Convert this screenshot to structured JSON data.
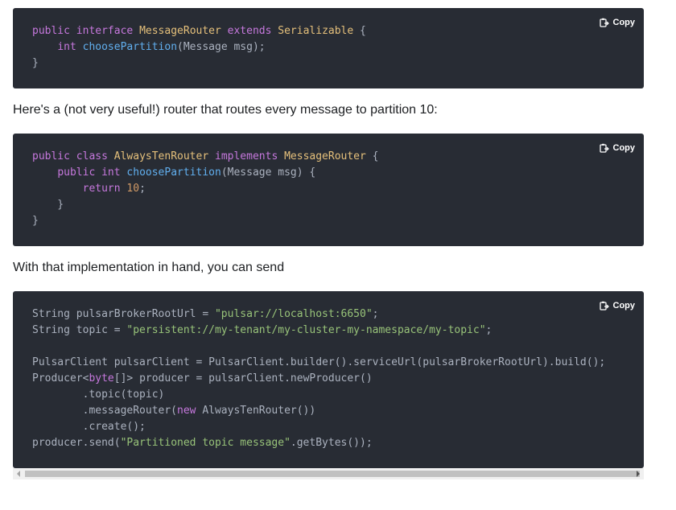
{
  "copy_label": "Copy",
  "icons": {
    "copy": "clipboard-copy-icon"
  },
  "paragraphs": [
    "Here's a (not very useful!) router that routes every message to partition 10:",
    "With that implementation in hand, you can send"
  ],
  "code_blocks": [
    {
      "lines": [
        [
          [
            "kw",
            "public "
          ],
          [
            "kw",
            "interface "
          ],
          [
            "cls",
            "MessageRouter "
          ],
          [
            "kw",
            "extends "
          ],
          [
            "cls",
            "Serializable "
          ],
          [
            "",
            "{"
          ]
        ],
        [
          [
            "",
            "    "
          ],
          [
            "kw",
            "int "
          ],
          [
            "fn",
            "choosePartition"
          ],
          [
            "",
            "(Message msg);"
          ]
        ],
        [
          [
            "",
            "}"
          ]
        ]
      ]
    },
    {
      "lines": [
        [
          [
            "kw",
            "public "
          ],
          [
            "kw",
            "class "
          ],
          [
            "cls",
            "AlwaysTenRouter "
          ],
          [
            "kw",
            "implements "
          ],
          [
            "cls",
            "MessageRouter "
          ],
          [
            "",
            "{"
          ]
        ],
        [
          [
            "",
            "    "
          ],
          [
            "kw",
            "public "
          ],
          [
            "kw",
            "int "
          ],
          [
            "fn",
            "choosePartition"
          ],
          [
            "",
            "(Message msg) {"
          ]
        ],
        [
          [
            "",
            "        "
          ],
          [
            "kw",
            "return "
          ],
          [
            "num",
            "10"
          ],
          [
            "",
            ";"
          ]
        ],
        [
          [
            "",
            "    }"
          ]
        ],
        [
          [
            "",
            "}"
          ]
        ]
      ]
    },
    {
      "lines": [
        [
          [
            "",
            "String pulsarBrokerRootUrl = "
          ],
          [
            "str",
            "\"pulsar://localhost:6650\""
          ],
          [
            "",
            ";"
          ]
        ],
        [
          [
            "",
            "String topic = "
          ],
          [
            "str",
            "\"persistent://my-tenant/my-cluster-my-namespace/my-topic\""
          ],
          [
            "",
            ";"
          ]
        ],
        [
          [
            "",
            ""
          ]
        ],
        [
          [
            "",
            "PulsarClient pulsarClient = PulsarClient.builder().serviceUrl(pulsarBrokerRootUrl).build();"
          ]
        ],
        [
          [
            "",
            "Producer<"
          ],
          [
            "kw",
            "byte"
          ],
          [
            "",
            "[]> producer = pulsarClient.newProducer()"
          ]
        ],
        [
          [
            "",
            "        .topic(topic)"
          ]
        ],
        [
          [
            "",
            "        .messageRouter("
          ],
          [
            "kw",
            "new "
          ],
          [
            "",
            "AlwaysTenRouter())"
          ]
        ],
        [
          [
            "",
            "        .create();"
          ]
        ],
        [
          [
            "",
            "producer.send("
          ],
          [
            "str",
            "\"Partitioned topic message\""
          ],
          [
            "",
            ".getBytes());"
          ]
        ]
      ]
    }
  ]
}
